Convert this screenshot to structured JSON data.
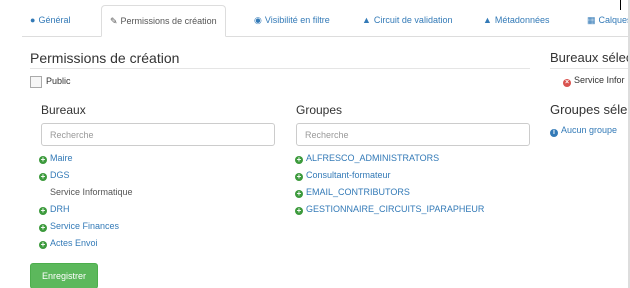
{
  "tabs": [
    {
      "icon": "info-circle-icon",
      "label": "Général",
      "active": false
    },
    {
      "icon": "pencil-icon",
      "label": "Permissions de création",
      "active": true
    },
    {
      "icon": "eye-icon",
      "label": "Visibilité en filtre",
      "active": false
    },
    {
      "icon": "sitemap-icon",
      "label": "Circuit de validation",
      "active": false
    },
    {
      "icon": "sitemap-icon",
      "label": "Métadonnées",
      "active": false
    },
    {
      "icon": "columns-icon",
      "label": "Calques",
      "active": false
    }
  ],
  "section_title": "Permissions de création",
  "public_label": "Public",
  "public_checked": false,
  "bureaux": {
    "title": "Bureaux",
    "search_placeholder": "Recherche",
    "items": [
      {
        "label": "Maire",
        "type": "link"
      },
      {
        "label": "DGS",
        "type": "link"
      },
      {
        "label": "Service Informatique",
        "type": "plain"
      },
      {
        "label": "DRH",
        "type": "link"
      },
      {
        "label": "Service Finances",
        "type": "link"
      },
      {
        "label": "Actes Envoi",
        "type": "link"
      }
    ]
  },
  "groupes": {
    "title": "Groupes",
    "search_placeholder": "Recherche",
    "items": [
      {
        "label": "ALFRESCO_ADMINISTRATORS",
        "type": "link"
      },
      {
        "label": "Consultant-formateur",
        "type": "link"
      },
      {
        "label": "EMAIL_CONTRIBUTORS",
        "type": "link"
      },
      {
        "label": "GESTIONNAIRE_CIRCUITS_IPARAPHEUR",
        "type": "link"
      }
    ]
  },
  "right_panel": {
    "bureaux_title": "Bureaux sélec",
    "selected_bureau": "Service Infor",
    "groupes_title": "Groupes séle",
    "no_group": "Aucun groupe"
  },
  "save_label": "Enregistrer",
  "colors": {
    "link": "#337ab7",
    "success": "#5cb85c",
    "danger": "#d9534f"
  }
}
